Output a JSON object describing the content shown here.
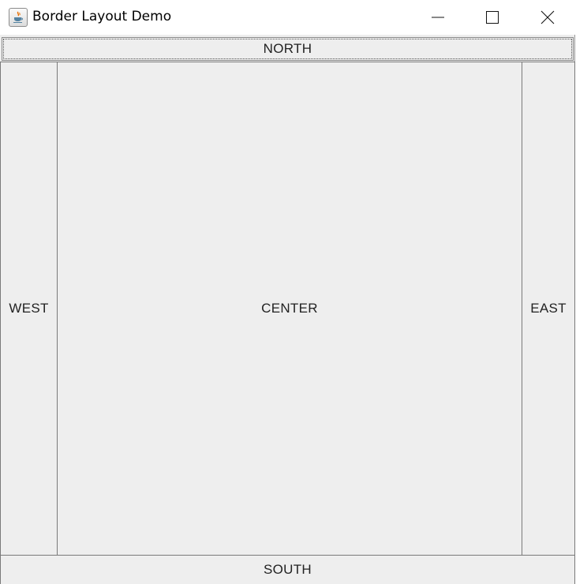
{
  "window": {
    "title": "Border Layout Demo",
    "app_icon": "java-coffee-icon",
    "controls": {
      "minimize_icon": "minimize-icon",
      "maximize_icon": "maximize-icon",
      "close_icon": "close-icon"
    }
  },
  "layout": {
    "north": "NORTH",
    "west": "WEST",
    "center": "CENTER",
    "east": "EAST",
    "south": "SOUTH"
  },
  "colors": {
    "panel_background": "#eeeeee",
    "border": "#7a7a7a",
    "label_text": "#222222",
    "titlebar_background": "#ffffff"
  }
}
